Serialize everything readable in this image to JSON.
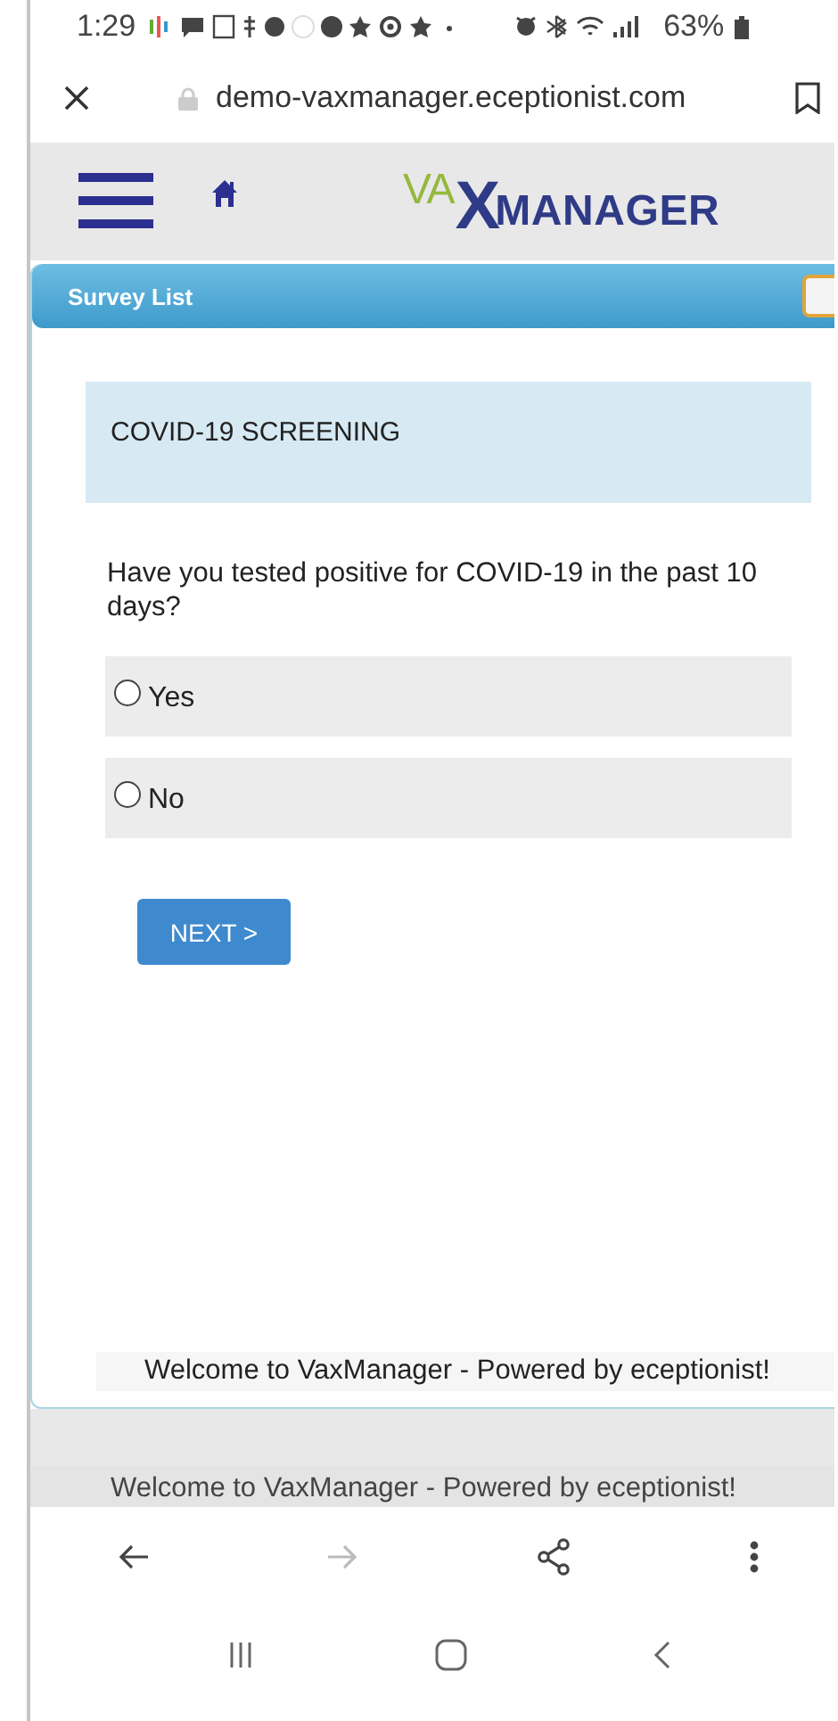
{
  "status_bar": {
    "time": "1:29",
    "battery": "63%"
  },
  "browser": {
    "url": "demo-vaxmanager.eceptionist.com"
  },
  "logo": {
    "prefix": "VA",
    "mark": "X",
    "suffix": "MANAGER"
  },
  "panel": {
    "title": "Survey List"
  },
  "survey": {
    "title": "COVID-19 SCREENING",
    "question": "Have you tested positive for COVID-19 in the past 10 days?",
    "options": [
      {
        "label": "Yes",
        "selected": false
      },
      {
        "label": "No",
        "selected": false
      }
    ],
    "next_button": "NEXT >"
  },
  "footers": [
    "Welcome to VaxManager - Powered by eceptionist!",
    "Welcome to VaxManager - Powered by eceptionist!"
  ],
  "nav_buttons": [
    {
      "kind": "back",
      "disabled": false
    },
    {
      "kind": "forward",
      "disabled": true
    },
    {
      "kind": "share",
      "disabled": false
    },
    {
      "kind": "more",
      "disabled": false
    }
  ]
}
